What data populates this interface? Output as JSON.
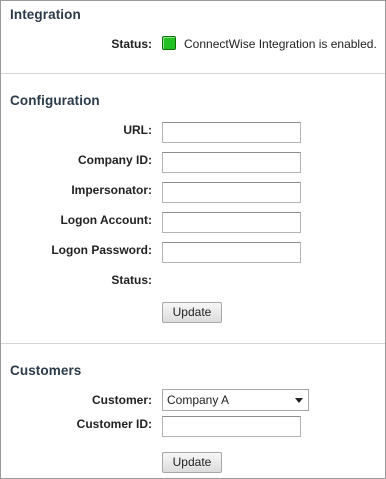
{
  "integration": {
    "title": "Integration",
    "status_label": "Status:",
    "status_text": "ConnectWise Integration is enabled.",
    "status_color": "#22c022"
  },
  "configuration": {
    "title": "Configuration",
    "url_label": "URL:",
    "url_value": "",
    "company_id_label": "Company ID:",
    "company_id_value": "",
    "impersonator_label": "Impersonator:",
    "impersonator_value": "",
    "logon_account_label": "Logon Account:",
    "logon_account_value": "",
    "logon_password_label": "Logon Password:",
    "logon_password_value": "",
    "status_label": "Status:",
    "update_label": "Update"
  },
  "customers": {
    "title": "Customers",
    "customer_label": "Customer:",
    "customer_selected": "Company A",
    "customer_id_label": "Customer ID:",
    "customer_id_value": "",
    "update_label": "Update"
  }
}
